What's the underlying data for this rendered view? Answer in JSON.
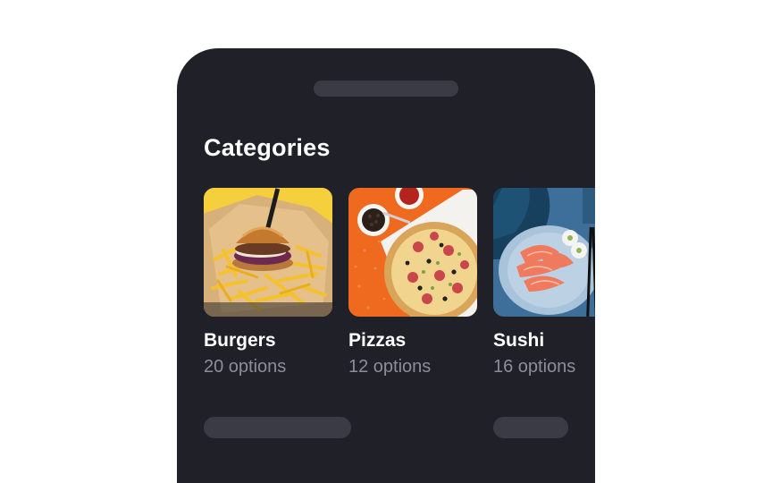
{
  "screen": {
    "section_title": "Categories"
  },
  "categories": [
    {
      "name": "Burgers",
      "count": "20 options",
      "photo": "burger-fries-photo"
    },
    {
      "name": "Pizzas",
      "count": "12 options",
      "photo": "pizza-photo"
    },
    {
      "name": "Sushi",
      "count": "16 options",
      "photo": "salmon-sashimi-photo"
    }
  ],
  "colors": {
    "phone_background": "#1f2028",
    "placeholder": "#3a3b44",
    "title_text": "#ffffff",
    "secondary_text": "#8c8d96"
  }
}
